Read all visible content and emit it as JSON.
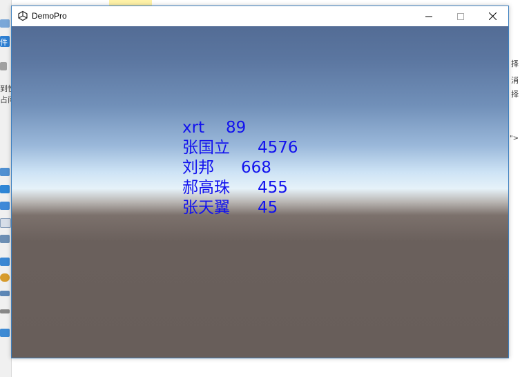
{
  "window": {
    "title": "DemoPro",
    "icons": {
      "app": "unity-logo-icon",
      "minimize": "minimize-icon",
      "maximize": "maximize-icon",
      "close": "close-icon"
    }
  },
  "scores": [
    {
      "name": "xrt",
      "value": "89"
    },
    {
      "name": "张国立",
      "value": "4576"
    },
    {
      "name": "刘邦",
      "value": "668"
    },
    {
      "name": "郝高珠",
      "value": "455"
    },
    {
      "name": "张天翼",
      "value": "45"
    }
  ],
  "background": {
    "left_texts": [
      "件",
      "到性",
      "占问"
    ],
    "right_texts": [
      "择",
      "消",
      "择",
      "é\">"
    ]
  },
  "colors": {
    "score_text": "#1212ee",
    "window_border": "#3c7fbf"
  }
}
